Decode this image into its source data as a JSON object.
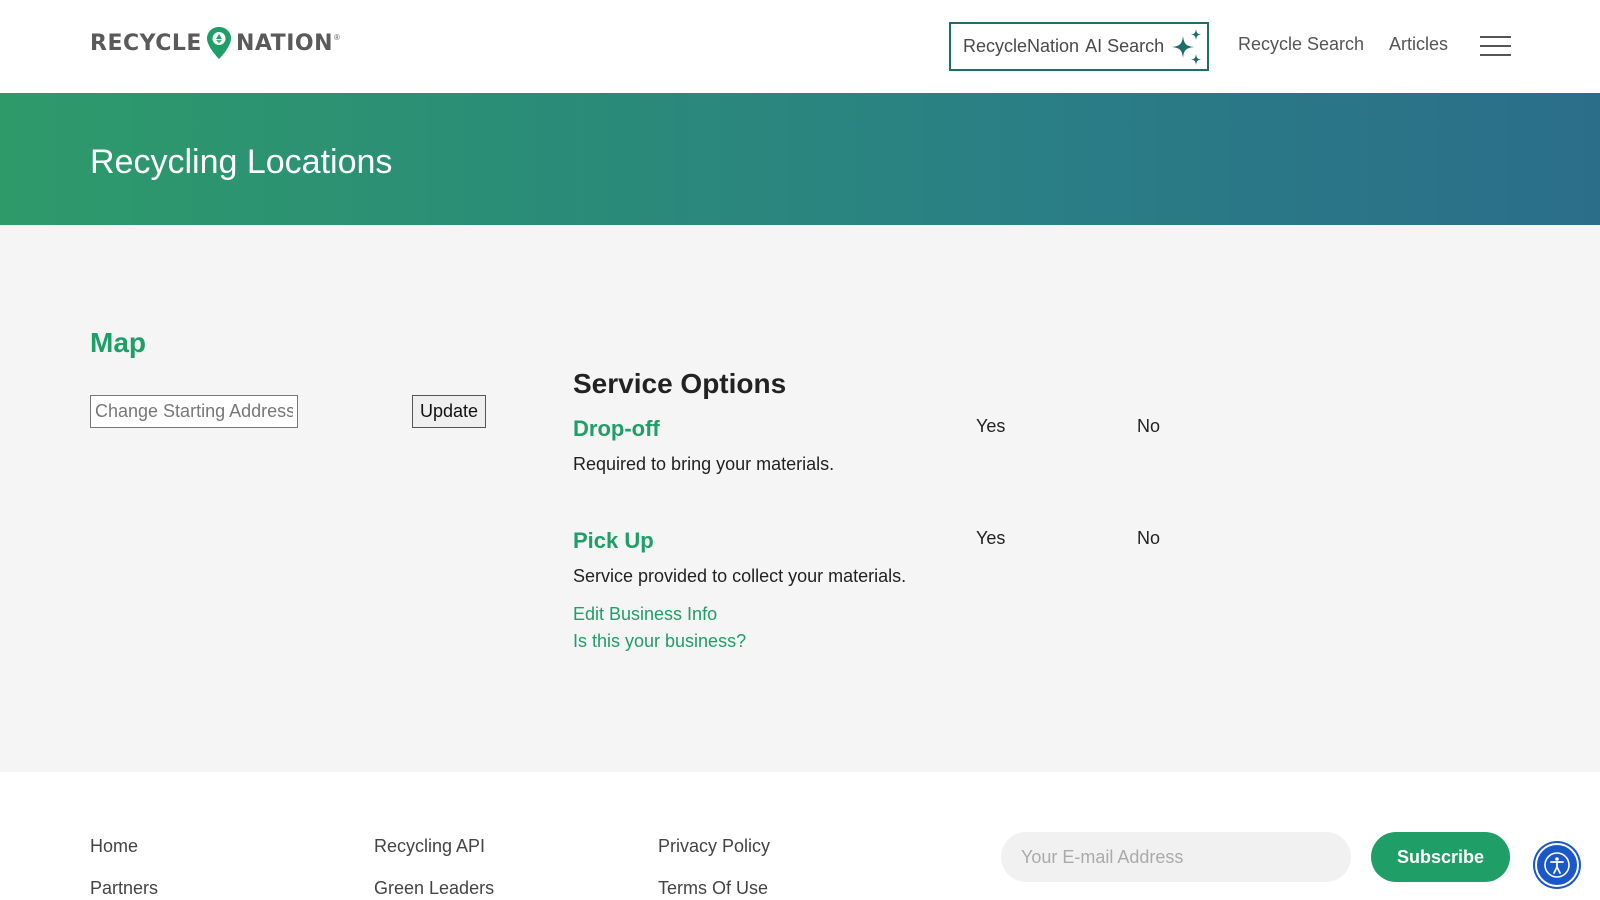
{
  "header": {
    "logo_left": "RECYCLE",
    "logo_right": "NATION",
    "logo_reg": "®",
    "ai_search_label": "RecycleNation",
    "ai_search_label2": "AI Search",
    "nav": [
      "Recycle Search",
      "Articles"
    ]
  },
  "banner": {
    "title": "Recycling Locations"
  },
  "map": {
    "title": "Map",
    "address_placeholder": "Change Starting Address",
    "update_label": "Update"
  },
  "service_options": {
    "title": "Service Options",
    "items": [
      {
        "name": "Drop-off",
        "description": "Required to bring your materials.",
        "yes": "Yes",
        "no": "No"
      },
      {
        "name": "Pick Up",
        "description": "Service provided to collect your materials.",
        "yes": "Yes",
        "no": "No"
      }
    ],
    "links": [
      "Edit Business Info",
      "Is this your business?"
    ]
  },
  "footer": {
    "col1": [
      "Home",
      "Partners"
    ],
    "col2": [
      "Recycling API",
      "Green Leaders"
    ],
    "col3": [
      "Privacy Policy",
      "Terms Of Use"
    ],
    "email_placeholder": "Your E-mail Address",
    "subscribe_label": "Subscribe"
  },
  "colors": {
    "brand_green": "#1f9e67",
    "ai_border": "#1e6d68",
    "a11y_blue": "#1a57c9"
  },
  "icons": {
    "logo_pin": "map-pin-icon",
    "ai": "sparkle-icon",
    "menu": "hamburger-icon",
    "accessibility": "accessibility-icon"
  }
}
